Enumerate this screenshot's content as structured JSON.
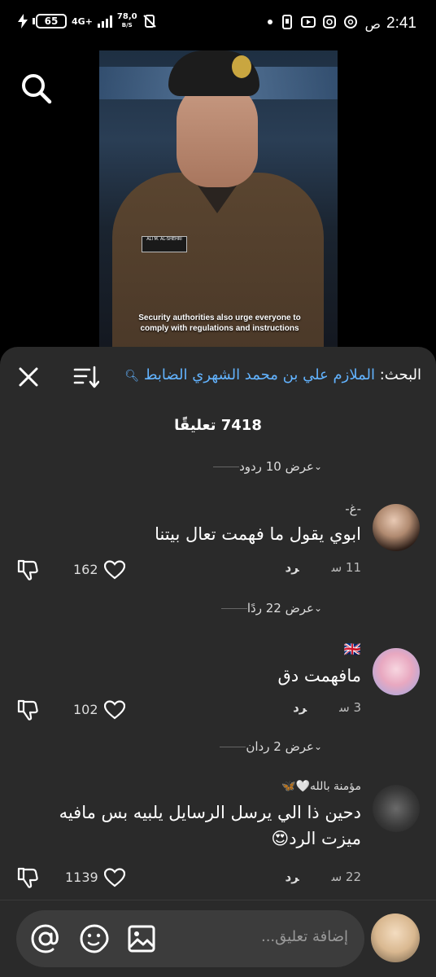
{
  "status_bar": {
    "time": "2:41",
    "ampm": "ص",
    "battery": "65",
    "network": "4G+",
    "net_speed_value": "78,0",
    "net_speed_unit": "B/S"
  },
  "video": {
    "caption": "Security authorities also urge everyone to comply with regulations and instructions",
    "name_tag": "ALI M. AL-SHEHRI"
  },
  "header": {
    "search_label": "البحث:",
    "search_query": "الملازم علي بن محمد الشهري الضابط"
  },
  "comments_count": "7418 تعليقًا",
  "top_replies_link": "عرض 10 ردود",
  "comments": [
    {
      "author": "-غ-",
      "text": "ابوي يقول ما فهمت تعال بيتنا",
      "time": "11 س",
      "reply": "رد",
      "likes": "162",
      "replies_link": "عرض 22 ردًا"
    },
    {
      "author": "🇬🇧",
      "text": "مافهمت دق",
      "time": "3 س",
      "reply": "رد",
      "likes": "102",
      "replies_link": "عرض 2 ردان"
    },
    {
      "author": "مؤمنة بالله🤍🦋",
      "text": "دحين ذا الي يرسل الرسايل يلبيه بس مافيه ميزت الرد😍",
      "time": "22 س",
      "reply": "رد",
      "likes": "1139"
    }
  ],
  "input": {
    "placeholder": "إضافة تعليق..."
  },
  "colors": {
    "accent": "#62b3ff",
    "sheet_bg": "#2a2a2a",
    "input_bg": "#3c3c3c"
  }
}
